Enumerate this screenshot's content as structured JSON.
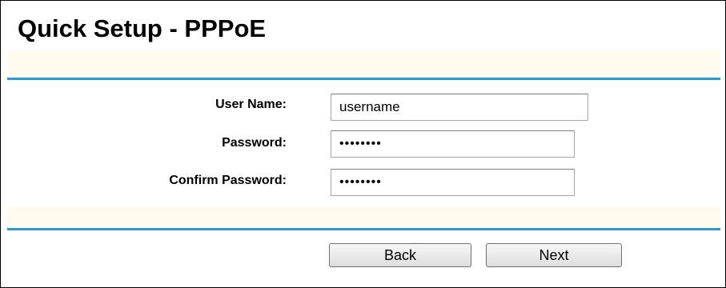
{
  "page": {
    "title": "Quick Setup - PPPoE"
  },
  "form": {
    "user_name_label": "User Name:",
    "user_name_value": "username",
    "password_label": "Password:",
    "password_value": "password",
    "confirm_password_label": "Confirm Password:",
    "confirm_password_value": "password"
  },
  "buttons": {
    "back_label": "Back",
    "next_label": "Next"
  },
  "colors": {
    "accent_rule": "#2a9ad6",
    "band_background": "#fffcee"
  }
}
